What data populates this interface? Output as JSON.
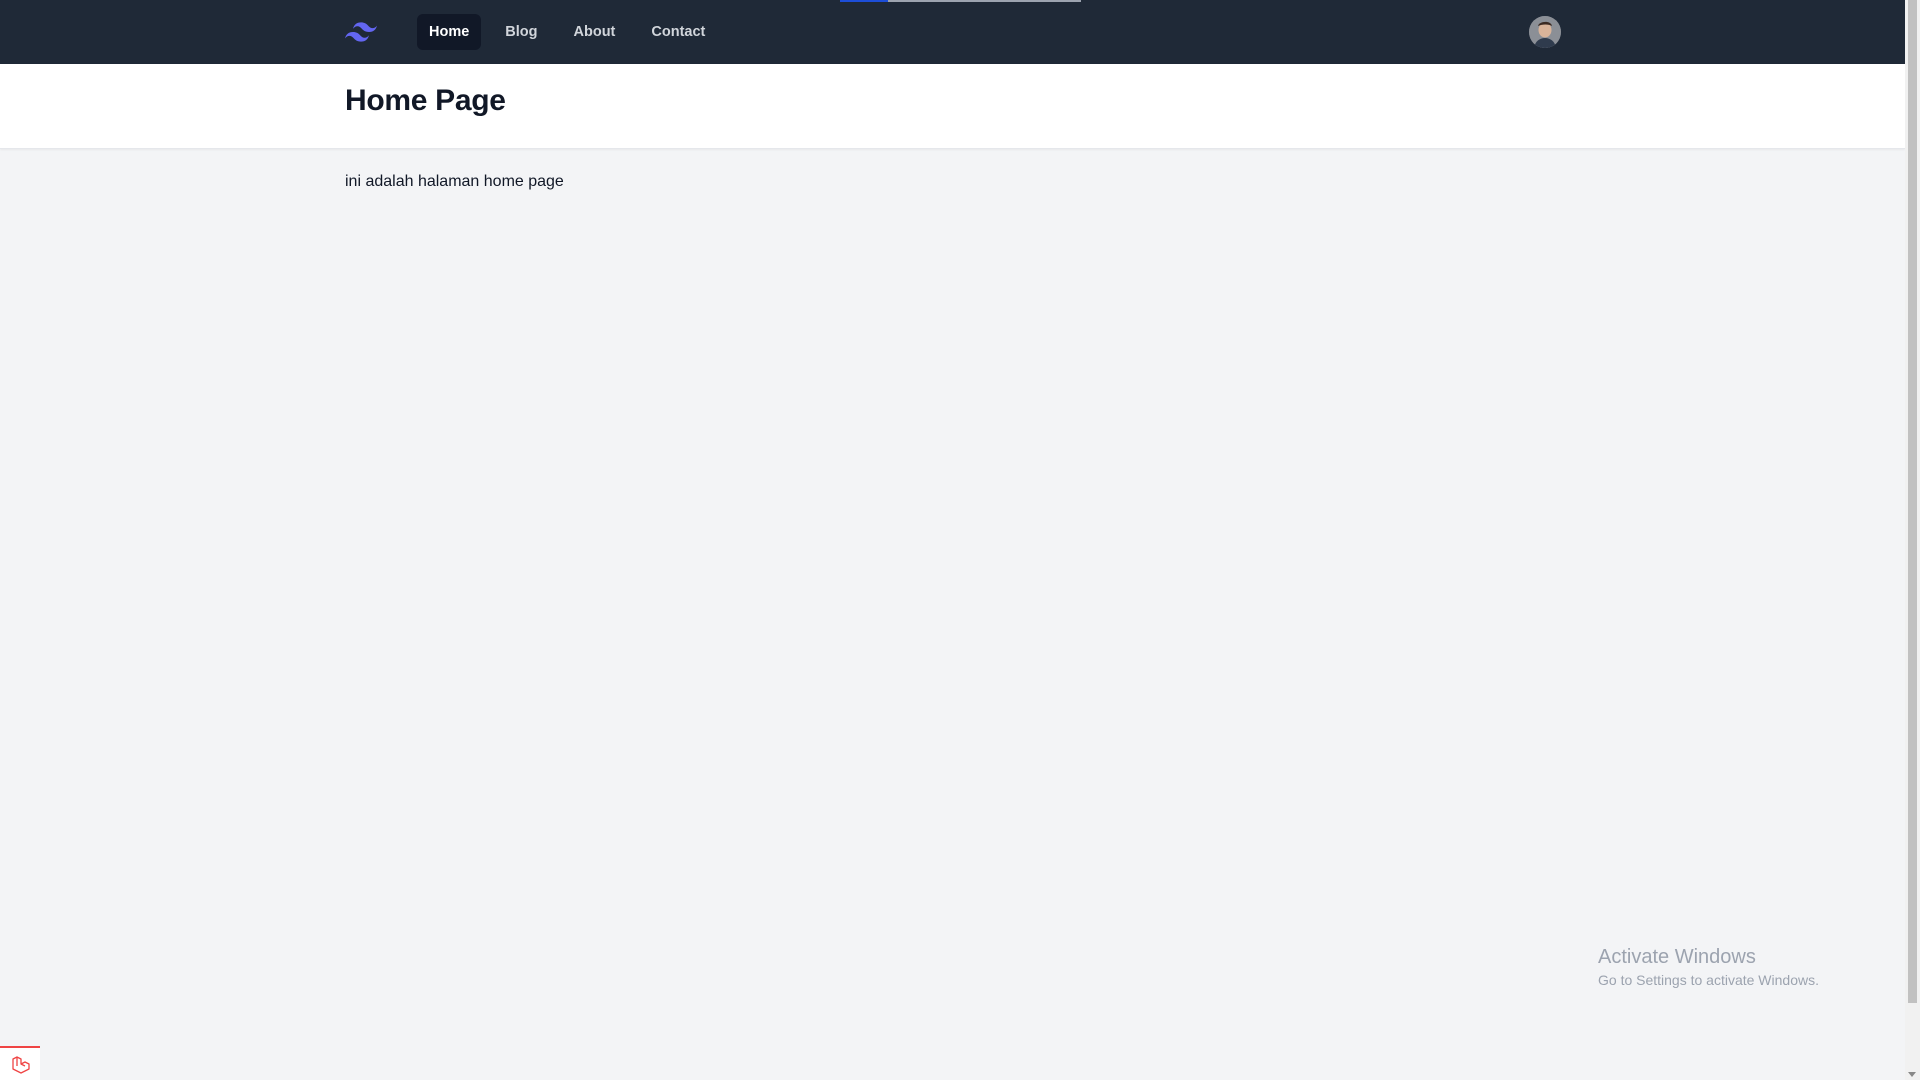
{
  "colors": {
    "navbar_bg": "#1f2937",
    "active_link_bg": "#111827",
    "page_bg": "#f3f4f6",
    "logo": "#6366f1",
    "progress": "#1d4ed8"
  },
  "navbar": {
    "logo_icon": "tailwind-logo-icon",
    "links": [
      {
        "label": "Home",
        "active": true
      },
      {
        "label": "Blog",
        "active": false
      },
      {
        "label": "About",
        "active": false
      },
      {
        "label": "Contact",
        "active": false
      }
    ],
    "avatar_icon": "user-avatar"
  },
  "header": {
    "title": "Home Page"
  },
  "main": {
    "text": "ini adalah halaman home page"
  },
  "watermark": {
    "title": "Activate Windows",
    "subtitle": "Go to Settings to activate Windows."
  },
  "devtools": {
    "icon": "laravel-icon"
  }
}
